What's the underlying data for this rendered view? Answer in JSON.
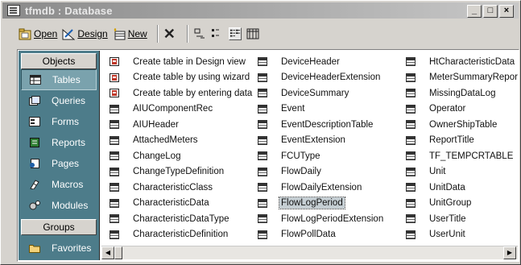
{
  "window": {
    "title": "tfmdb : Database",
    "minimize": "_",
    "maximize": "□",
    "close": "×"
  },
  "toolbar": {
    "open_label": "Open",
    "open_accel": "O",
    "design_label": "Design",
    "design_accel": "D",
    "new_label": "New",
    "new_accel": "N",
    "delete_label": "✕"
  },
  "sidebar": {
    "objects_header": "Objects",
    "items": [
      {
        "label": "Tables",
        "icon": "table-icon",
        "active": true
      },
      {
        "label": "Queries",
        "icon": "query-icon",
        "active": false
      },
      {
        "label": "Forms",
        "icon": "form-icon",
        "active": false
      },
      {
        "label": "Reports",
        "icon": "report-icon",
        "active": false
      },
      {
        "label": "Pages",
        "icon": "page-icon",
        "active": false
      },
      {
        "label": "Macros",
        "icon": "macro-icon",
        "active": false
      },
      {
        "label": "Modules",
        "icon": "module-icon",
        "active": false
      }
    ],
    "groups_header": "Groups",
    "groups": [
      {
        "label": "Favorites",
        "icon": "folder-icon"
      }
    ]
  },
  "list": {
    "columns": [
      [
        {
          "label": "Create table in Design view",
          "icon": "wizard-icon"
        },
        {
          "label": "Create table by using wizard",
          "icon": "wizard-icon"
        },
        {
          "label": "Create table by entering data",
          "icon": "wizard-icon"
        },
        {
          "label": "AIUComponentRec",
          "icon": "table-icon"
        },
        {
          "label": "AIUHeader",
          "icon": "table-icon"
        },
        {
          "label": "AttachedMeters",
          "icon": "table-icon"
        },
        {
          "label": "ChangeLog",
          "icon": "table-icon"
        },
        {
          "label": "ChangeTypeDefinition",
          "icon": "table-icon"
        },
        {
          "label": "CharacteristicClass",
          "icon": "table-icon"
        },
        {
          "label": "CharacteristicData",
          "icon": "table-icon"
        },
        {
          "label": "CharacteristicDataType",
          "icon": "table-icon"
        },
        {
          "label": "CharacteristicDefinition",
          "icon": "table-icon"
        }
      ],
      [
        {
          "label": "DeviceHeader",
          "icon": "table-icon"
        },
        {
          "label": "DeviceHeaderExtension",
          "icon": "table-icon"
        },
        {
          "label": "DeviceSummary",
          "icon": "table-icon"
        },
        {
          "label": "Event",
          "icon": "table-icon"
        },
        {
          "label": "EventDescriptionTable",
          "icon": "table-icon"
        },
        {
          "label": "EventExtension",
          "icon": "table-icon"
        },
        {
          "label": "FCUType",
          "icon": "table-icon"
        },
        {
          "label": "FlowDaily",
          "icon": "table-icon"
        },
        {
          "label": "FlowDailyExtension",
          "icon": "table-icon"
        },
        {
          "label": "FlowLogPeriod",
          "icon": "table-icon",
          "selected": true
        },
        {
          "label": "FlowLogPeriodExtension",
          "icon": "table-icon"
        },
        {
          "label": "FlowPollData",
          "icon": "table-icon"
        }
      ],
      [
        {
          "label": "HtCharacteristicData",
          "icon": "table-icon"
        },
        {
          "label": "MeterSummaryReport",
          "icon": "table-icon"
        },
        {
          "label": "MissingDataLog",
          "icon": "table-icon"
        },
        {
          "label": "Operator",
          "icon": "table-icon"
        },
        {
          "label": "OwnerShipTable",
          "icon": "table-icon"
        },
        {
          "label": "ReportTitle",
          "icon": "table-icon"
        },
        {
          "label": "TF_TEMPCRTABLE",
          "icon": "table-icon"
        },
        {
          "label": "Unit",
          "icon": "table-icon"
        },
        {
          "label": "UnitData",
          "icon": "table-icon"
        },
        {
          "label": "UnitGroup",
          "icon": "table-icon"
        },
        {
          "label": "UserTitle",
          "icon": "table-icon"
        },
        {
          "label": "UserUnit",
          "icon": "table-icon"
        }
      ]
    ]
  },
  "colors": {
    "sidebar_bg": "#4d7c8a",
    "selected_bg": "#c5ced3",
    "chrome": "#d6d3ce"
  }
}
